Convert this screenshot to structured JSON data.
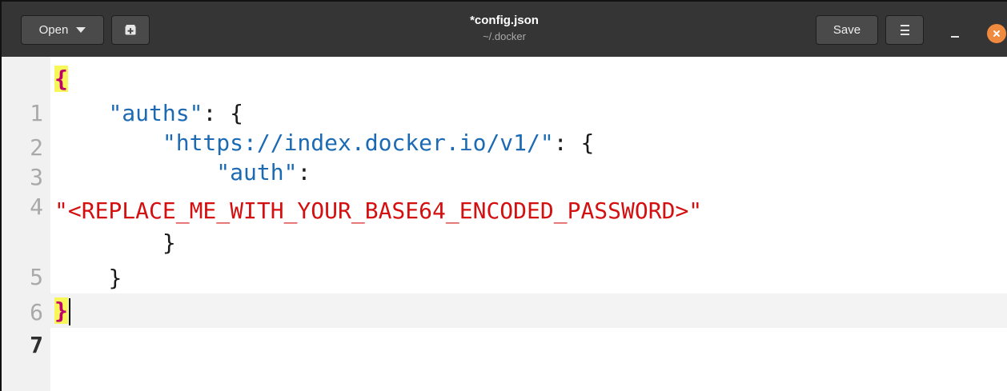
{
  "header": {
    "open_label": "Open",
    "title": "*config.json",
    "subtitle": "~/.docker",
    "save_label": "Save"
  },
  "icons": {
    "open": "chevron-down-icon",
    "new_document": "new-tab-icon",
    "menu": "hamburger-menu-icon",
    "minimize": "minimize-icon",
    "close": "close-icon"
  },
  "colors": {
    "headerbar": "#353535",
    "button": "#4a4a4a",
    "close_button": "#f08a3e",
    "json_key": "#1b6ab3",
    "json_string": "#d40f0f",
    "bracket_match_highlight": "#f7f75a",
    "bracket_match_text": "#c2006b"
  },
  "editor": {
    "current_line": "7",
    "lines": [
      {
        "number": "1",
        "indent": "",
        "parts": [
          "{"
        ]
      },
      {
        "number": "2",
        "indent": "    ",
        "parts": [
          "\"auths\"",
          ": {"
        ]
      },
      {
        "number": "3",
        "indent": "        ",
        "parts": [
          "\"https://index.docker.io/v1/\"",
          ": {"
        ]
      },
      {
        "number": "4",
        "indent": "            ",
        "parts": [
          "\"auth\"",
          ":"
        ]
      },
      {
        "number": "",
        "indent": "",
        "parts": [
          "\"<REPLACE_ME_WITH_YOUR_BASE64_ENCODED_PASSWORD>\""
        ]
      },
      {
        "number": "5",
        "indent": "        ",
        "parts": [
          "}"
        ]
      },
      {
        "number": "6",
        "indent": "    ",
        "parts": [
          "}"
        ]
      },
      {
        "number": "7",
        "indent": "",
        "parts": [
          "}"
        ]
      }
    ]
  }
}
